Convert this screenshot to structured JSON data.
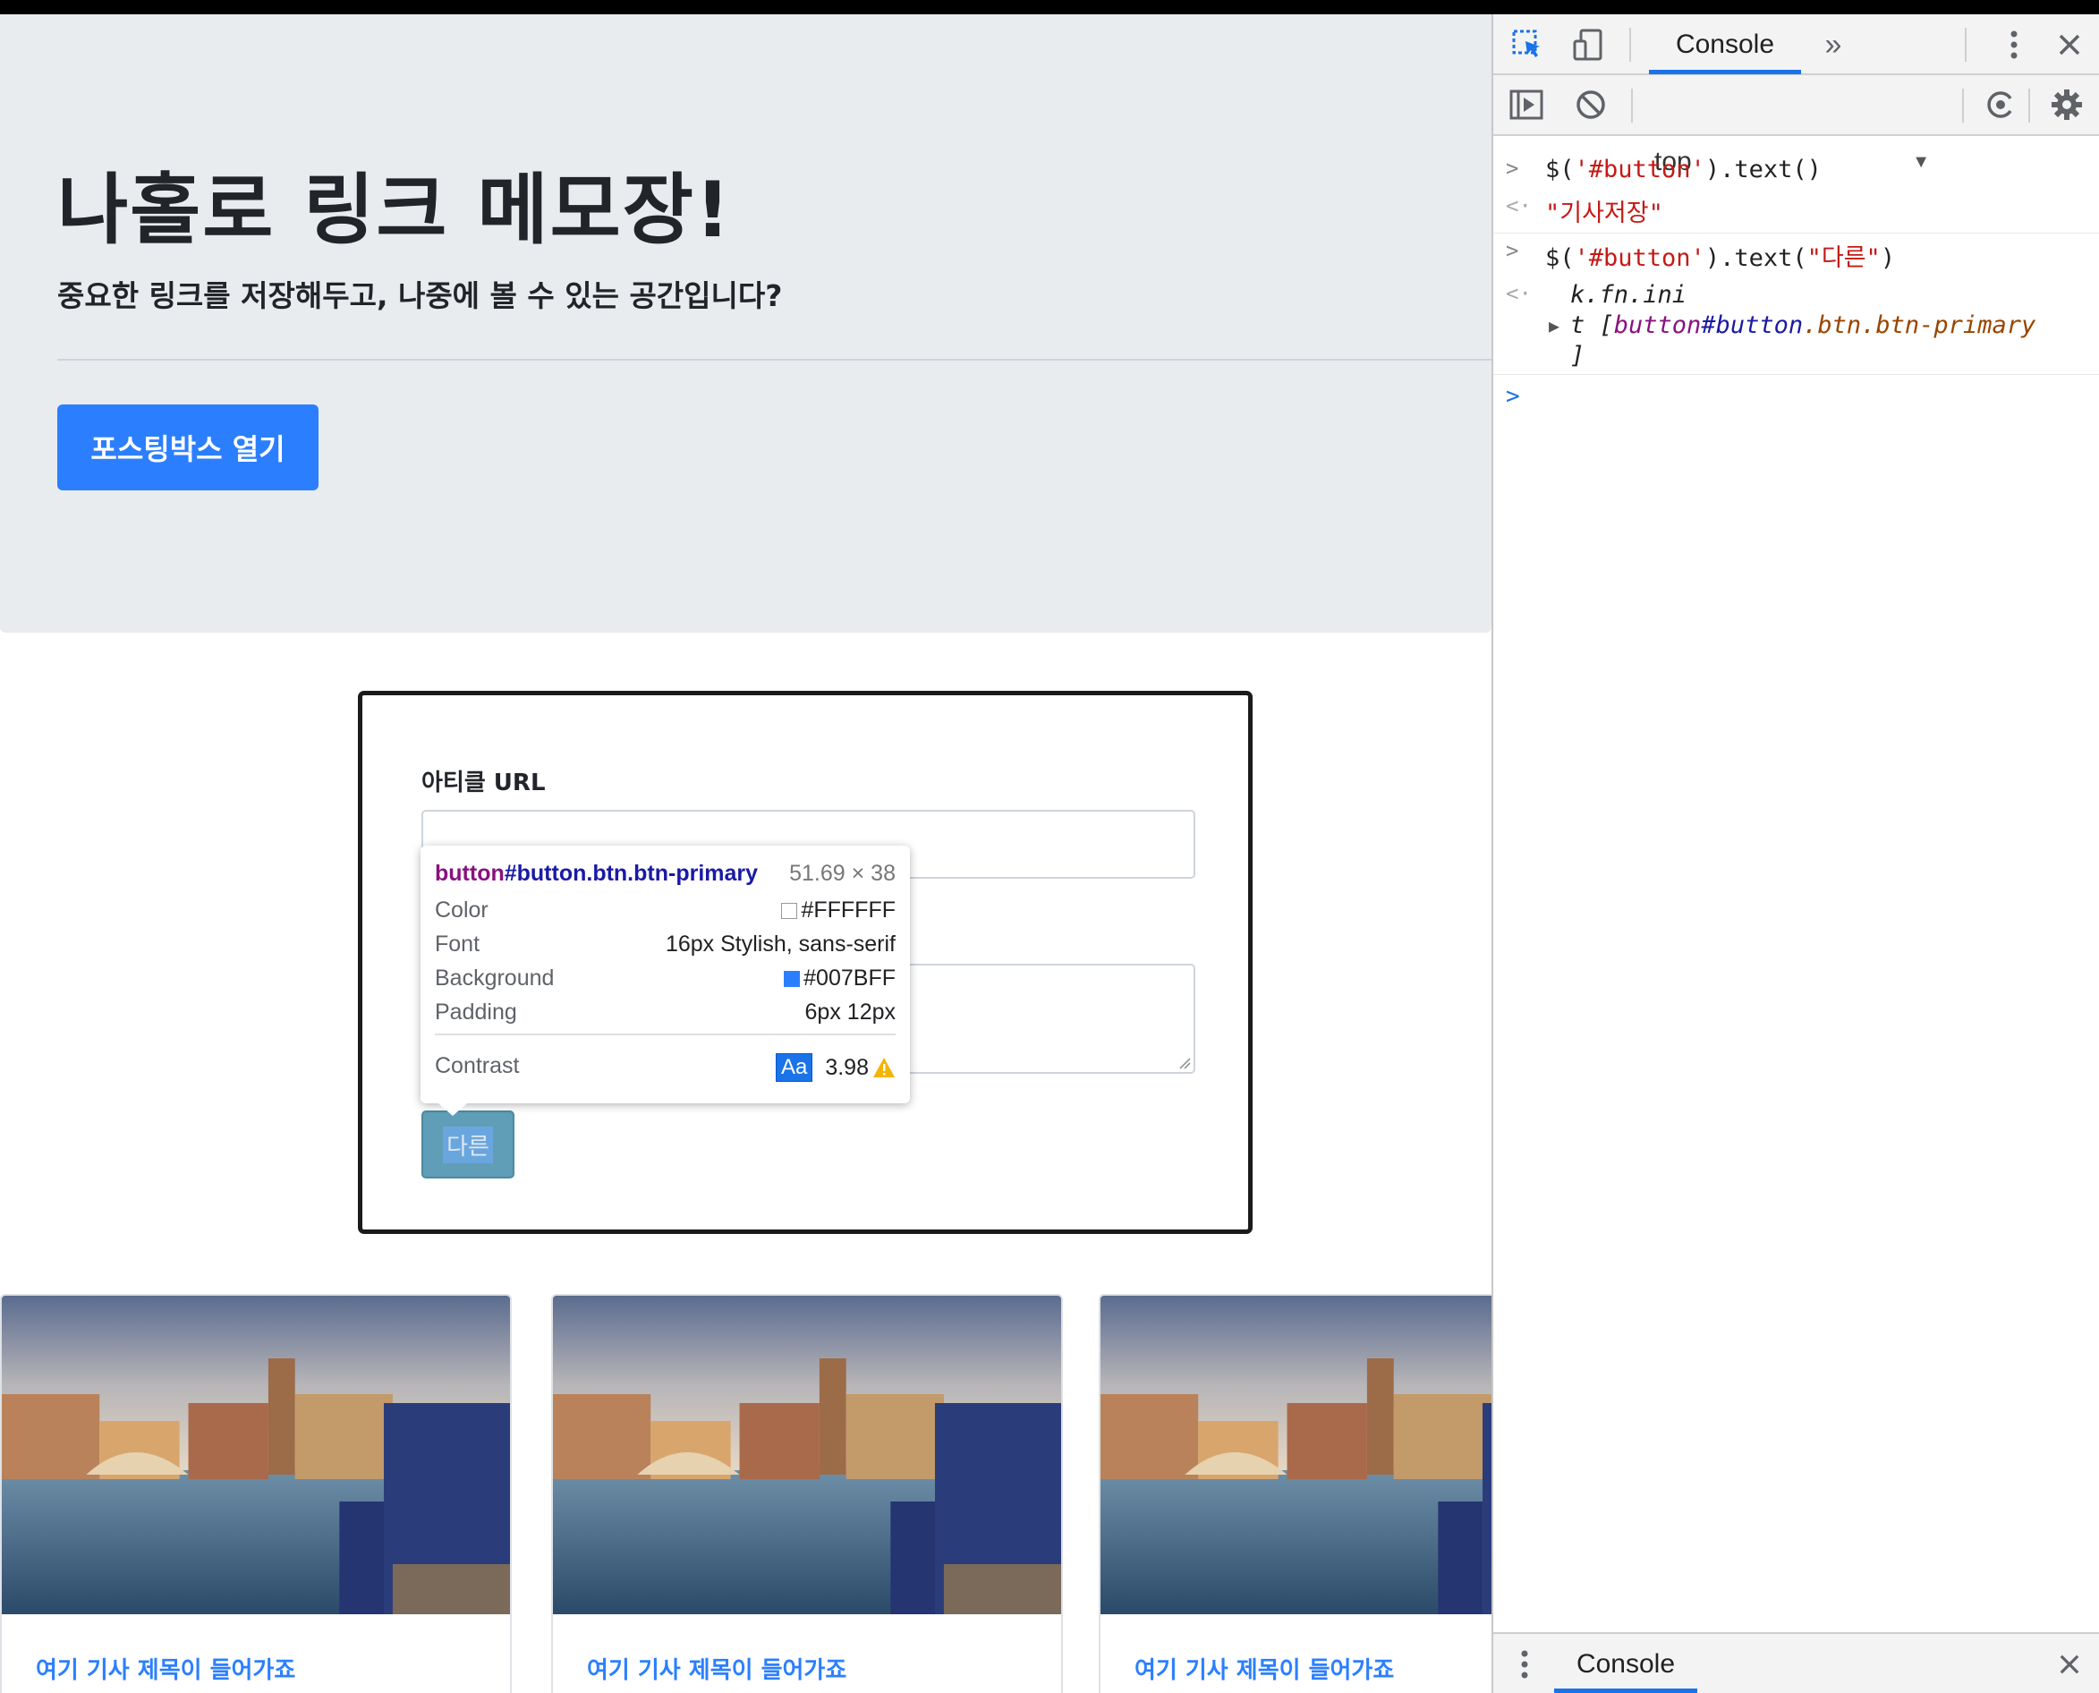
{
  "page": {
    "title": "나홀로 링크 메모장!",
    "subtitle": "중요한 링크를 저장해두고, 나중에 볼 수 있는 공간입니다?",
    "open_button": "포스팅박스 열기",
    "form": {
      "url_label": "아티클 URL",
      "url_value": "",
      "comment_value": "",
      "submit_button": "다른"
    },
    "cards": [
      {
        "title": "여기 기사 제목이 들어가죠"
      },
      {
        "title": "여기 기사 제목이 들어가죠"
      },
      {
        "title": "여기 기사 제목이 들어가죠"
      }
    ]
  },
  "tooltip": {
    "tag": "button",
    "selector": "#button.btn.btn-primary",
    "size": "51.69 × 38",
    "rows": [
      {
        "key": "Color",
        "value": "#FFFFFF",
        "swatch": "#FFFFFF"
      },
      {
        "key": "Font",
        "value": "16px Stylish, sans-serif"
      },
      {
        "key": "Background",
        "value": "#007BFF",
        "swatch": "#2b7fff"
      },
      {
        "key": "Padding",
        "value": "6px 12px"
      }
    ],
    "contrast_label": "Contrast",
    "contrast_badge": "Aa",
    "contrast_value": "3.98"
  },
  "devtools": {
    "tab": "Console",
    "context": "top",
    "drawer_tab": "Console",
    "console": {
      "cmd1_prefix": "$(",
      "cmd1_arg": "'#button'",
      "cmd1_suffix": ").text()",
      "out1": "\"기사저장\"",
      "cmd2_prefix": "$(",
      "cmd2_arg": "'#button'",
      "cmd2_mid": ").text(",
      "cmd2_arg2": "\"다른\"",
      "cmd2_suffix": ")",
      "out2_line1": "k.fn.ini",
      "out2_line2_a": "t [",
      "out2_line2_tag": "button",
      "out2_line2_id": "#button",
      "out2_line2_cls": ".btn.btn-primary",
      "out2_line3": "]",
      "prompt": ">"
    }
  },
  "colors": {
    "primary": "#2b7fff",
    "jumbotron": "#e9ecef",
    "devtools_accent": "#1a73e8"
  }
}
